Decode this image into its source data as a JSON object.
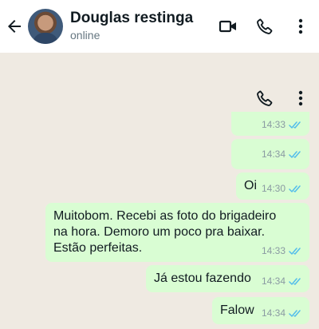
{
  "header": {
    "contact_name": "Douglas restinga",
    "status": "online",
    "icons": {
      "back": "arrow-left-icon",
      "video": "video-camera-icon",
      "call": "phone-icon",
      "menu": "more-vertical-icon"
    }
  },
  "floating_icons": {
    "call": "phone-icon",
    "menu": "more-vertical-icon"
  },
  "messages": [
    {
      "text": "",
      "time": "14:33",
      "status": "read"
    },
    {
      "text": "",
      "time": "14:34",
      "status": "read"
    },
    {
      "text": "Oi",
      "time": "14:30",
      "status": "read"
    },
    {
      "lines": [
        "Muitobom. Recebi as foto do brigadeiro",
        "na hora. Demoro um poco pra baixar.",
        "Estão perfeitas."
      ],
      "time": "14:33",
      "status": "read"
    },
    {
      "text": "Já estou fazendo",
      "time": "14:34",
      "status": "read"
    },
    {
      "text": "Falow",
      "time": "14:34",
      "status": "read"
    }
  ],
  "colors": {
    "chat_background": "#efeae2",
    "outgoing_bubble": "#d9fdd3",
    "read_ticks": "#53bdeb"
  }
}
